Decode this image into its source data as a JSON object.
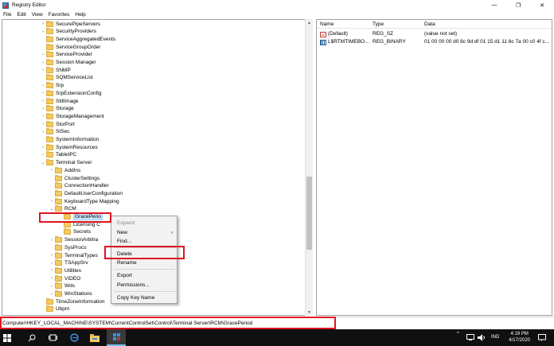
{
  "window": {
    "title": "Registry Editor",
    "minimize_glyph": "—",
    "maximize_glyph": "❐",
    "close_glyph": "✕"
  },
  "menu": [
    "File",
    "Edit",
    "View",
    "Favorites",
    "Help"
  ],
  "tree": [
    {
      "label": "SecurePipeServers",
      "indent": 0,
      "exp": ">"
    },
    {
      "label": "SecurityProviders",
      "indent": 0,
      "exp": ">"
    },
    {
      "label": "ServiceAggregatedEvents",
      "indent": 0,
      "exp": ""
    },
    {
      "label": "ServiceGroupOrder",
      "indent": 0,
      "exp": ""
    },
    {
      "label": "ServiceProvider",
      "indent": 0,
      "exp": ">"
    },
    {
      "label": "Session Manager",
      "indent": 0,
      "exp": ">"
    },
    {
      "label": "SNMP",
      "indent": 0,
      "exp": ">"
    },
    {
      "label": "SQMServiceList",
      "indent": 0,
      "exp": ""
    },
    {
      "label": "Srp",
      "indent": 0,
      "exp": ">"
    },
    {
      "label": "SrpExtensionConfig",
      "indent": 0,
      "exp": ">"
    },
    {
      "label": "StillImage",
      "indent": 0,
      "exp": ">"
    },
    {
      "label": "Storage",
      "indent": 0,
      "exp": ">"
    },
    {
      "label": "StorageManagement",
      "indent": 0,
      "exp": ">"
    },
    {
      "label": "StorPort",
      "indent": 0,
      "exp": ">"
    },
    {
      "label": "StSec",
      "indent": 0,
      "exp": ">"
    },
    {
      "label": "SystemInformation",
      "indent": 0,
      "exp": ""
    },
    {
      "label": "SystemResources",
      "indent": 0,
      "exp": ">"
    },
    {
      "label": "TabletPC",
      "indent": 0,
      "exp": ">"
    },
    {
      "label": "Terminal Server",
      "indent": 0,
      "exp": "v"
    },
    {
      "label": "AddIns",
      "indent": 1,
      "exp": ">"
    },
    {
      "label": "ClusterSettings",
      "indent": 1,
      "exp": ""
    },
    {
      "label": "ConnectionHandler",
      "indent": 1,
      "exp": ""
    },
    {
      "label": "DefaultUserConfiguration",
      "indent": 1,
      "exp": ""
    },
    {
      "label": "KeyboardType Mapping",
      "indent": 1,
      "exp": ">"
    },
    {
      "label": "RCM",
      "indent": 1,
      "exp": "v"
    },
    {
      "label": "GracePerio",
      "indent": 2,
      "exp": "",
      "selected": true
    },
    {
      "label": "Licensing C",
      "indent": 2,
      "exp": ""
    },
    {
      "label": "Secrets",
      "indent": 2,
      "exp": ""
    },
    {
      "label": "SessionArbitra",
      "indent": 1,
      "exp": ">"
    },
    {
      "label": "SysProcs",
      "indent": 1,
      "exp": ""
    },
    {
      "label": "TerminalTypes",
      "indent": 1,
      "exp": ">"
    },
    {
      "label": "TSAppSrv",
      "indent": 1,
      "exp": ">"
    },
    {
      "label": "Utilities",
      "indent": 1,
      "exp": ">"
    },
    {
      "label": "VIDEO",
      "indent": 1,
      "exp": ">"
    },
    {
      "label": "Wds",
      "indent": 1,
      "exp": ">"
    },
    {
      "label": "WinStations",
      "indent": 1,
      "exp": ">"
    },
    {
      "label": "TimeZoneInformation",
      "indent": 0,
      "exp": ""
    },
    {
      "label": "Ubpm",
      "indent": 0,
      "exp": ""
    }
  ],
  "list": {
    "headers": {
      "name": "Name",
      "type": "Type",
      "data": "Data"
    },
    "rows": [
      {
        "icon": "string-value-icon",
        "icon_text": "ab",
        "name": "(Default)",
        "type": "REG_SZ",
        "data": "(value not set)"
      },
      {
        "icon": "binary-value-icon",
        "icon_text": "",
        "name": "L$RTMTIMEBO...",
        "type": "REG_BINARY",
        "data": "01 00 00 00 d0 8c 9d df 01 15 d1 11 8c 7a 00 c0 4f c..."
      }
    ]
  },
  "context_menu": {
    "items": [
      {
        "label": "Expand",
        "disabled": true
      },
      {
        "label": "New",
        "submenu": true,
        "arrow": "›"
      },
      {
        "label": "Find..."
      },
      {
        "label": "Delete"
      },
      {
        "label": "Rename"
      },
      {
        "label": "Export"
      },
      {
        "label": "Permissions..."
      },
      {
        "label": "Copy Key Name"
      }
    ]
  },
  "status": {
    "path": "Computer\\HKEY_LOCAL_MACHINE\\SYSTEM\\CurrentControlSet\\Control\\Terminal Server\\RCM\\GracePeriod"
  },
  "taskbar": {
    "tray_caret": "^",
    "tray_language": "IND",
    "time": "4:19 PM",
    "date": "4/17/2020"
  },
  "colors": {
    "highlight_red": "#e0141e",
    "selection_blue": "#cce8ff",
    "taskbar": "#101010"
  }
}
